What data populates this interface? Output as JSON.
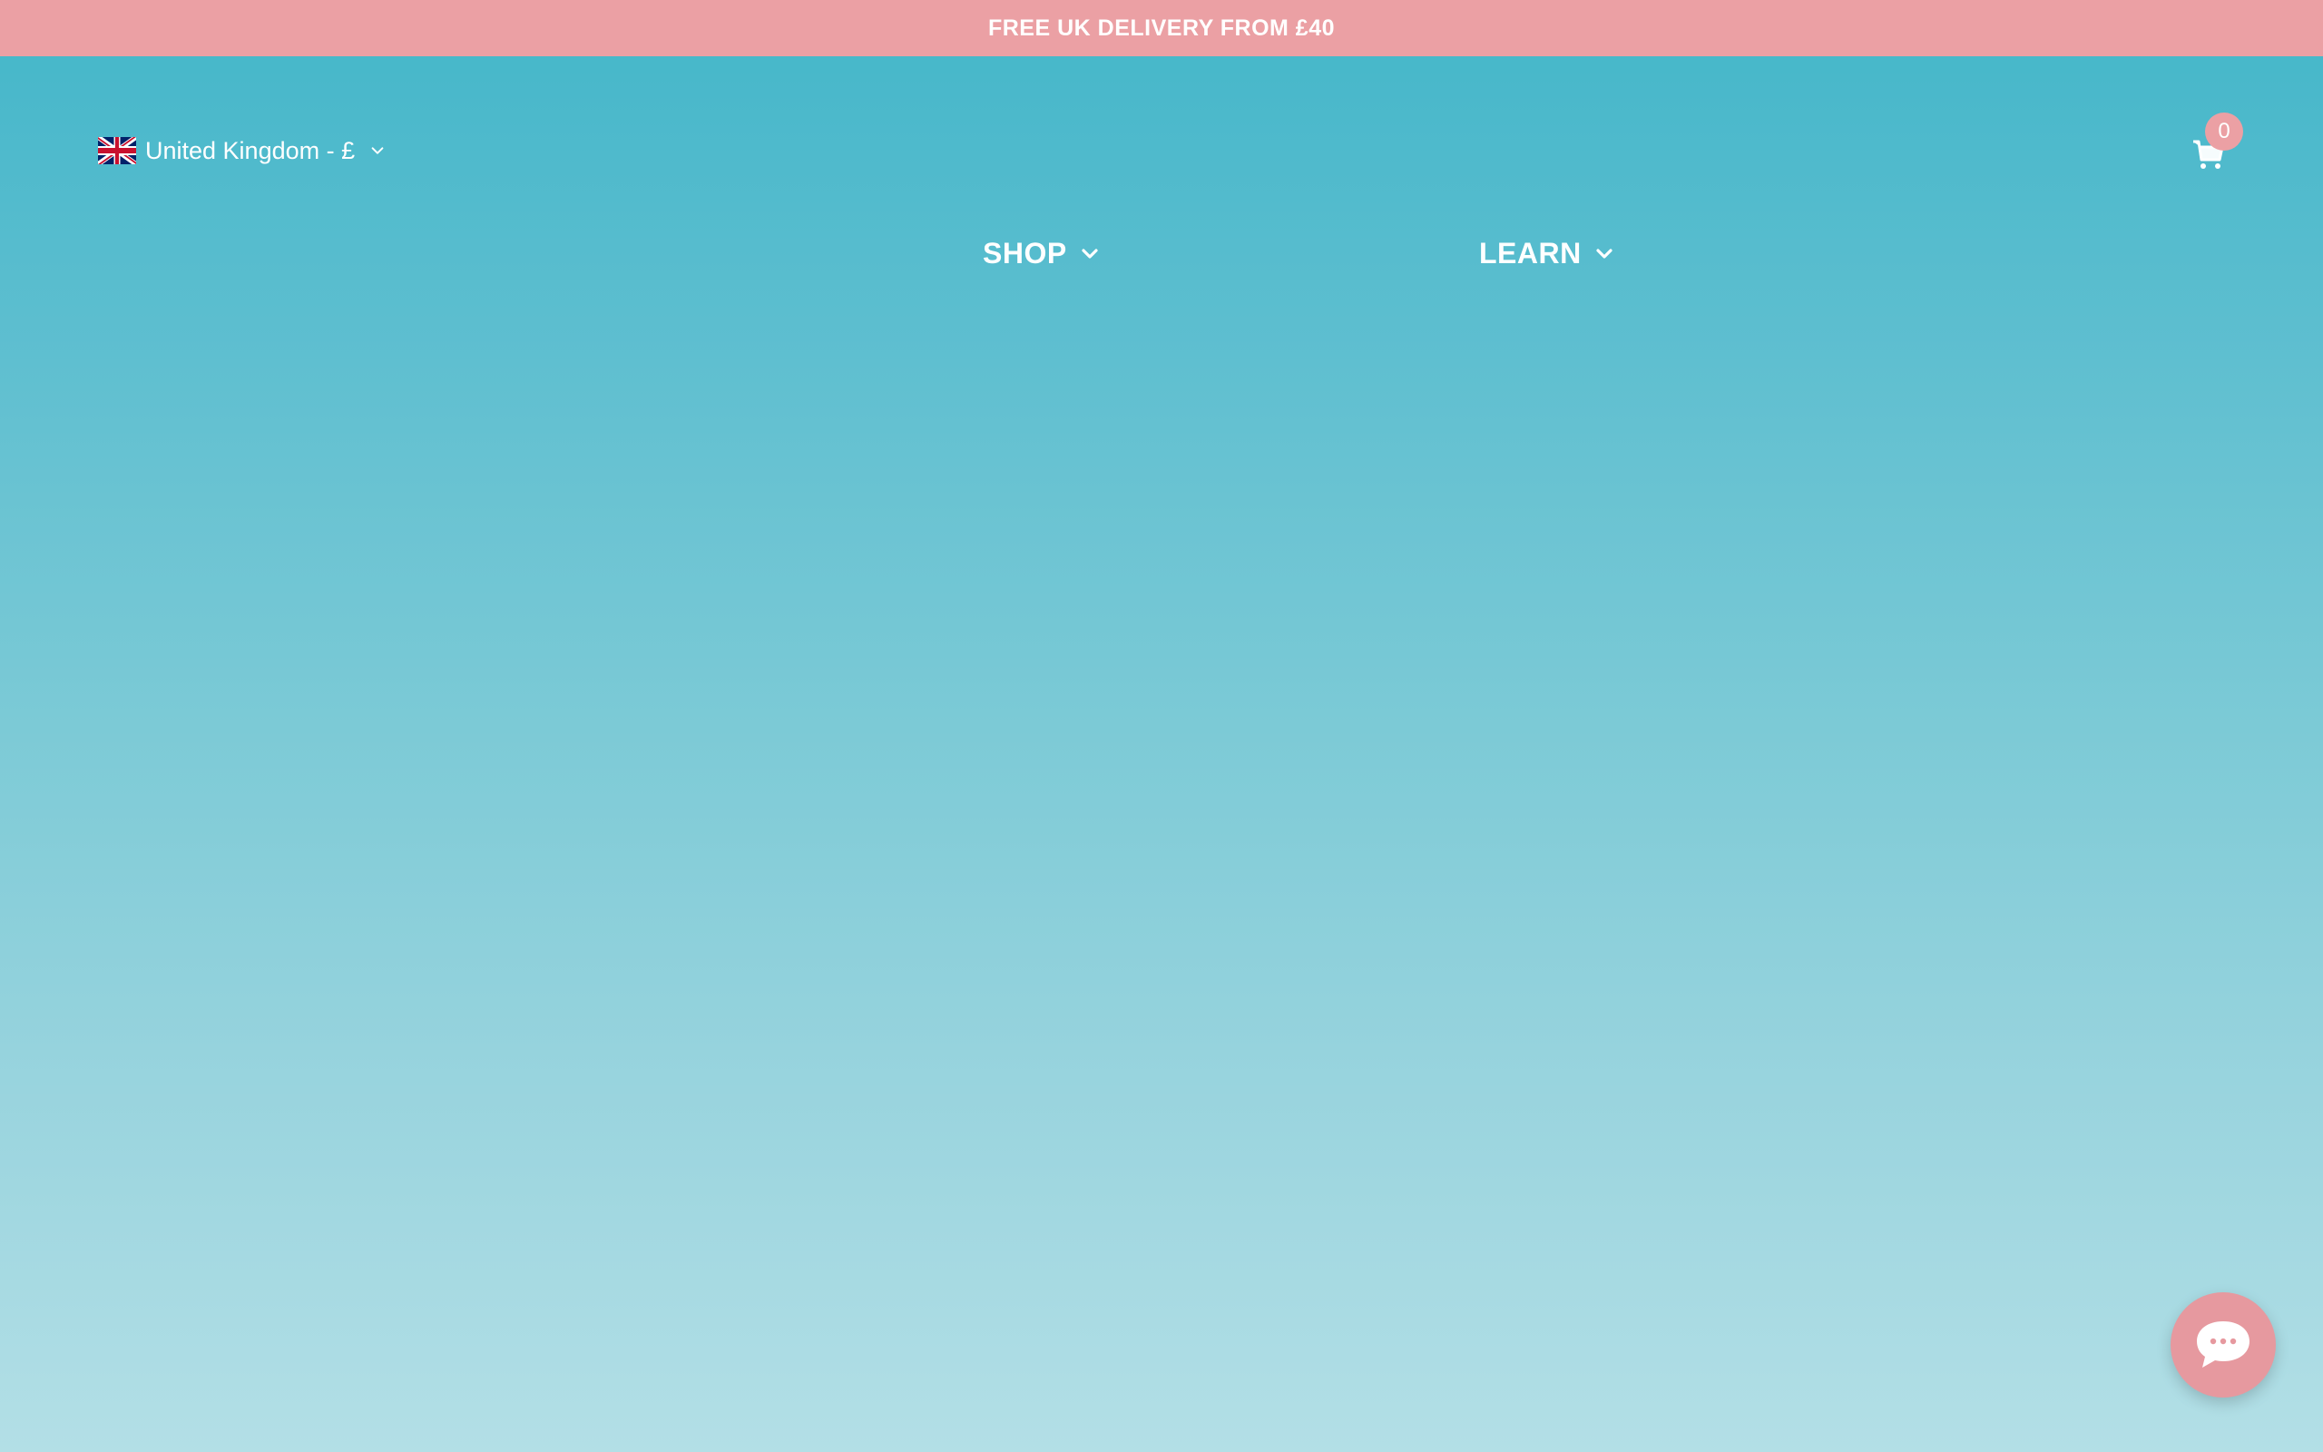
{
  "announcement": {
    "text": "FREE UK DELIVERY FROM £40",
    "background": "#eba0a4"
  },
  "locale": {
    "label": "United Kingdom - £",
    "flag_icon": "uk-flag-icon",
    "chevron_icon": "chevron-down-icon"
  },
  "cart": {
    "icon": "cart-icon",
    "count": "0"
  },
  "nav": {
    "items": [
      {
        "label": "SHOP",
        "icon": "chevron-down-icon"
      },
      {
        "label": "LEARN",
        "icon": "chevron-down-icon"
      }
    ]
  },
  "chat": {
    "icon": "chat-bubble-icon"
  },
  "colors": {
    "accent_pink": "#eba0a4",
    "gradient_top": "#43b6c9",
    "gradient_bottom": "#b3dfe6",
    "text": "#ffffff"
  }
}
